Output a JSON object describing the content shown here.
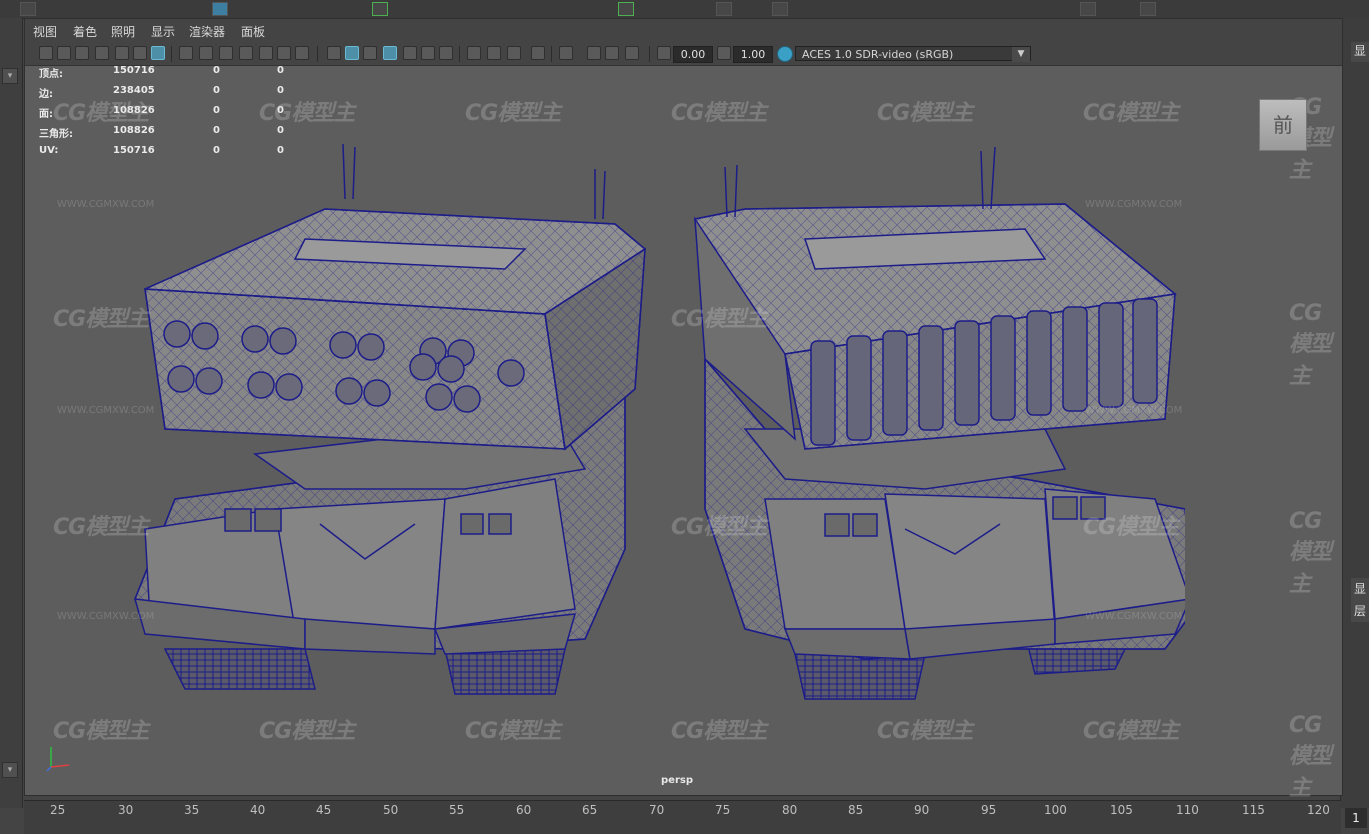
{
  "menu": {
    "items": [
      {
        "label": "视图"
      },
      {
        "label": "着色"
      },
      {
        "label": "照明"
      },
      {
        "label": "显示"
      },
      {
        "label": "渲染器"
      },
      {
        "label": "面板"
      }
    ]
  },
  "toolbar": {
    "exposure_value": "0.00",
    "gamma_value": "1.00",
    "color_space": "ACES 1.0 SDR-video (sRGB)"
  },
  "hud": {
    "rows": [
      {
        "label": "顶点:",
        "v1": "150716",
        "v2": "0",
        "v3": "0"
      },
      {
        "label": "边:",
        "v1": "238405",
        "v2": "0",
        "v3": "0"
      },
      {
        "label": "面:",
        "v1": "108826",
        "v2": "0",
        "v3": "0"
      },
      {
        "label": "三角形:",
        "v1": "108826",
        "v2": "0",
        "v3": "0"
      },
      {
        "label": "UV:",
        "v1": "150716",
        "v2": "0",
        "v3": "0"
      }
    ]
  },
  "viewcube": {
    "face_label": "前"
  },
  "viewport": {
    "camera_label": "persp"
  },
  "watermark": {
    "brand": "CG模型主",
    "url": "WWW.CGMXW.COM"
  },
  "timeline": {
    "ticks": [
      "25",
      "30",
      "35",
      "40",
      "45",
      "50",
      "55",
      "60",
      "65",
      "70",
      "75",
      "80",
      "85",
      "90",
      "95",
      "100",
      "105",
      "110",
      "115",
      "120"
    ],
    "current_frame": "1"
  },
  "right_panel": {
    "tab1": "显",
    "tab2": "层"
  },
  "colors": {
    "viewport_bg": "#5d5d5d",
    "wireframe": "#1d1d8a",
    "mesh_fill": "#7a7a7a",
    "active_icon": "#4e8fa8"
  }
}
